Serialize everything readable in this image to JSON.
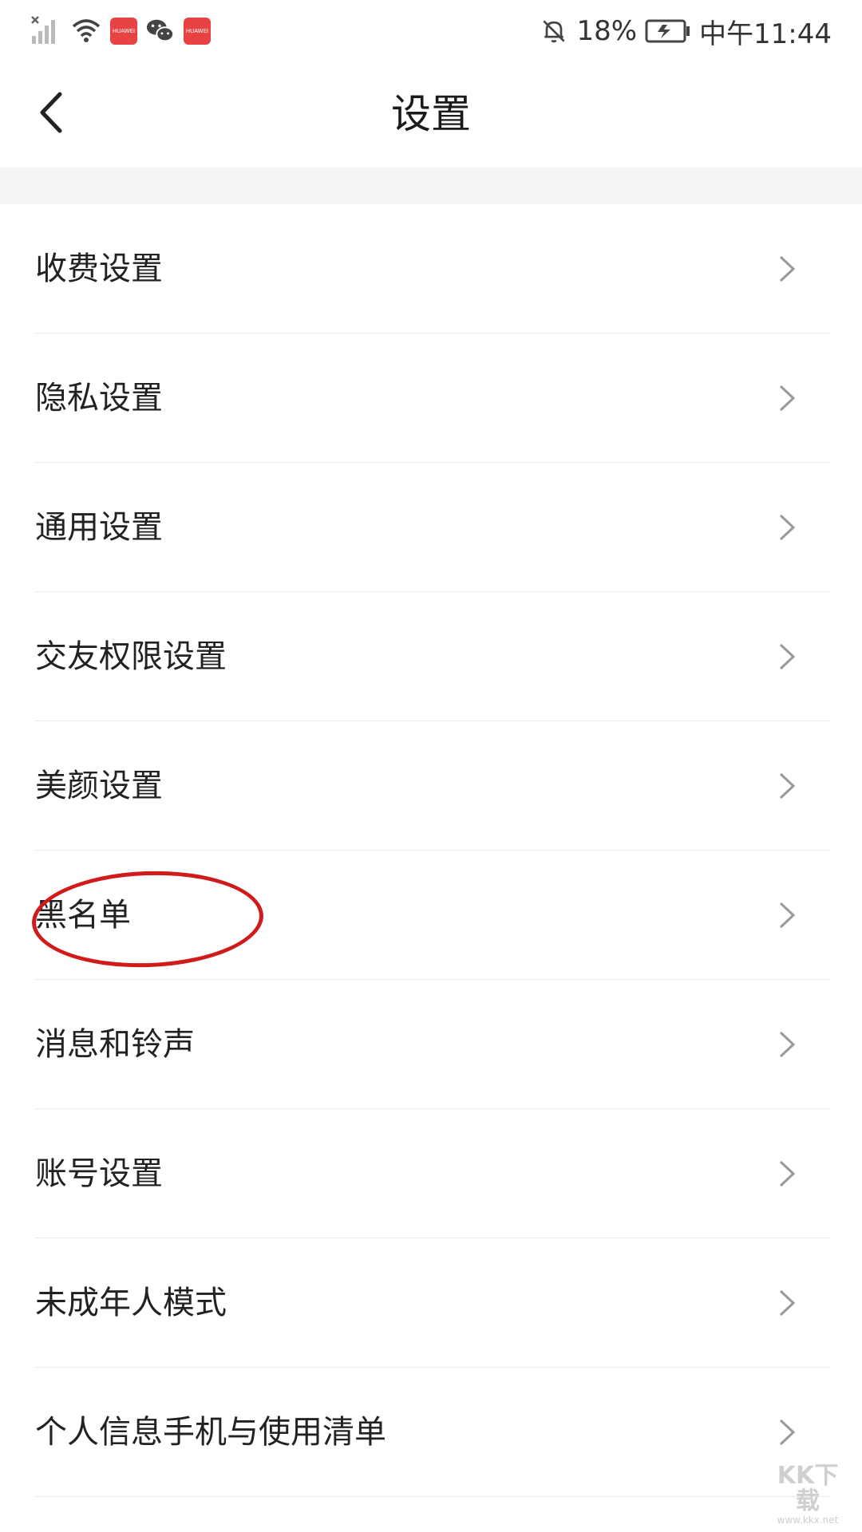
{
  "status_bar": {
    "battery_percent": "18%",
    "time": "中午11:44",
    "app_badges": [
      "HUAWEI",
      "HUAWEI"
    ],
    "icons": [
      "signal-x-icon",
      "wifi-icon",
      "huawei-appgallery-icon",
      "wechat-icon",
      "huawei-appgallery-icon",
      "bell-off-icon",
      "battery-charging-icon"
    ]
  },
  "nav": {
    "title": "设置",
    "back_icon": "back-arrow-icon"
  },
  "settings": {
    "items": [
      {
        "label": "收费设置"
      },
      {
        "label": "隐私设置"
      },
      {
        "label": "通用设置"
      },
      {
        "label": "交友权限设置"
      },
      {
        "label": "美颜设置"
      },
      {
        "label": "黑名单"
      },
      {
        "label": "消息和铃声"
      },
      {
        "label": "账号设置"
      },
      {
        "label": "未成年人模式"
      },
      {
        "label": "个人信息手机与使用清单"
      }
    ]
  },
  "annotation": {
    "highlighted_item": "黑名单",
    "color": "#d11a1a"
  },
  "watermark": {
    "main": "KK下载",
    "sub": "www.kkx.net"
  },
  "colors": {
    "background": "#ffffff",
    "section_gap": "#f4f4f4",
    "divider": "#ececec",
    "text": "#222222",
    "chevron": "#999999"
  }
}
